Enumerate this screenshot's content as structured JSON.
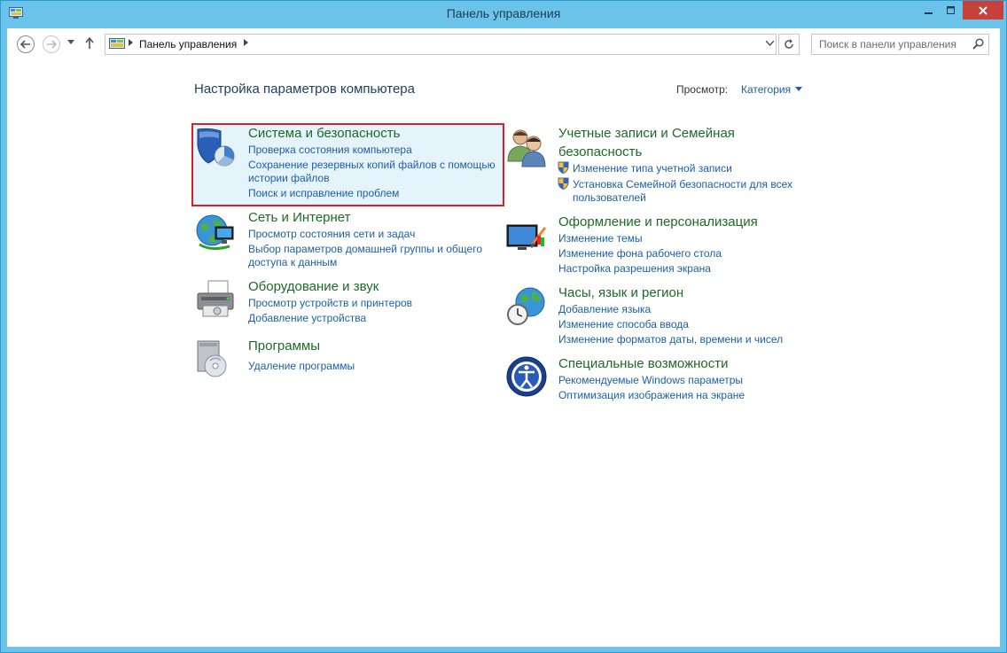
{
  "window": {
    "title": "Панель управления"
  },
  "nav": {
    "breadcrumb": "Панель управления",
    "search_placeholder": "Поиск в панели управления"
  },
  "content": {
    "heading": "Настройка параметров компьютера",
    "view_label": "Просмотр:",
    "view_value": "Категория"
  },
  "categories": {
    "system": {
      "title": "Система и безопасность",
      "links": [
        "Проверка состояния компьютера",
        "Сохранение резервных копий файлов с помощью",
        "истории файлов",
        "Поиск и исправление проблем"
      ]
    },
    "network": {
      "title": "Сеть и Интернет",
      "links": [
        "Просмотр состояния сети и задач",
        "Выбор параметров домашней группы и общего",
        "доступа к данным"
      ]
    },
    "hardware": {
      "title": "Оборудование и звук",
      "links": [
        "Просмотр устройств и принтеров",
        "Добавление устройства"
      ]
    },
    "programs": {
      "title": "Программы",
      "links": [
        "Удаление программы"
      ]
    },
    "accounts": {
      "title_line1": "Учетные записи и Семейная",
      "title_line2": "безопасность",
      "links": [
        "Изменение типа учетной записи",
        "Установка Семейной безопасности для всех",
        "пользователей"
      ]
    },
    "appearance": {
      "title": "Оформление и персонализация",
      "links": [
        "Изменение темы",
        "Изменение фона рабочего стола",
        "Настройка разрешения экрана"
      ]
    },
    "clock": {
      "title": "Часы, язык и регион",
      "links": [
        "Добавление языка",
        "Изменение способа ввода",
        "Изменение форматов даты, времени и чисел"
      ]
    },
    "access": {
      "title": "Специальные возможности",
      "links": [
        "Рекомендуемые Windows параметры",
        "Оптимизация изображения на экране"
      ]
    }
  },
  "colors": {
    "title_green": "#1d6a26",
    "link_blue": "#1c5fa8",
    "highlight_border": "#d3212d",
    "frame": "#6cc3ea"
  }
}
